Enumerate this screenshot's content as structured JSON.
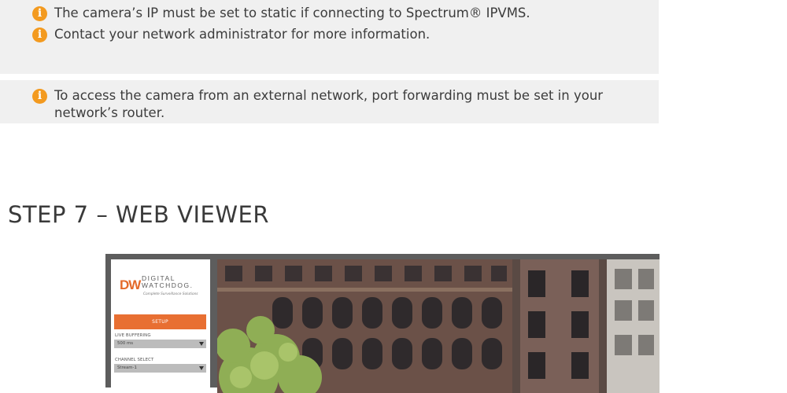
{
  "notes": [
    {
      "text": "The camera’s IP must be set to static if connecting to Spectrum® IPVMS."
    },
    {
      "text": "Contact your network administrator for more information."
    }
  ],
  "note2": {
    "text": "To access the camera from an external network, port forwarding must be set in your network’s router."
  },
  "step_title": "STEP 7 – WEB VIEWER",
  "viewer": {
    "logo": {
      "mark": "DW",
      "line1": "DIGITAL",
      "line2": "WATCHDOG.",
      "tagline": "Complete Surveillance Solutions"
    },
    "setup_label": "SETUP",
    "live_buffering": {
      "label": "LIVE BUFFERING",
      "value": "500 ms"
    },
    "channel_select": {
      "label": "CHANNEL SELECT",
      "value": "Stream-1"
    }
  },
  "colors": {
    "accent": "#e86f32",
    "info_icon": "#f39a1f",
    "note_bg": "#f0f0f0"
  },
  "icons": {
    "note": "info-icon",
    "select": "caret-down-icon"
  }
}
